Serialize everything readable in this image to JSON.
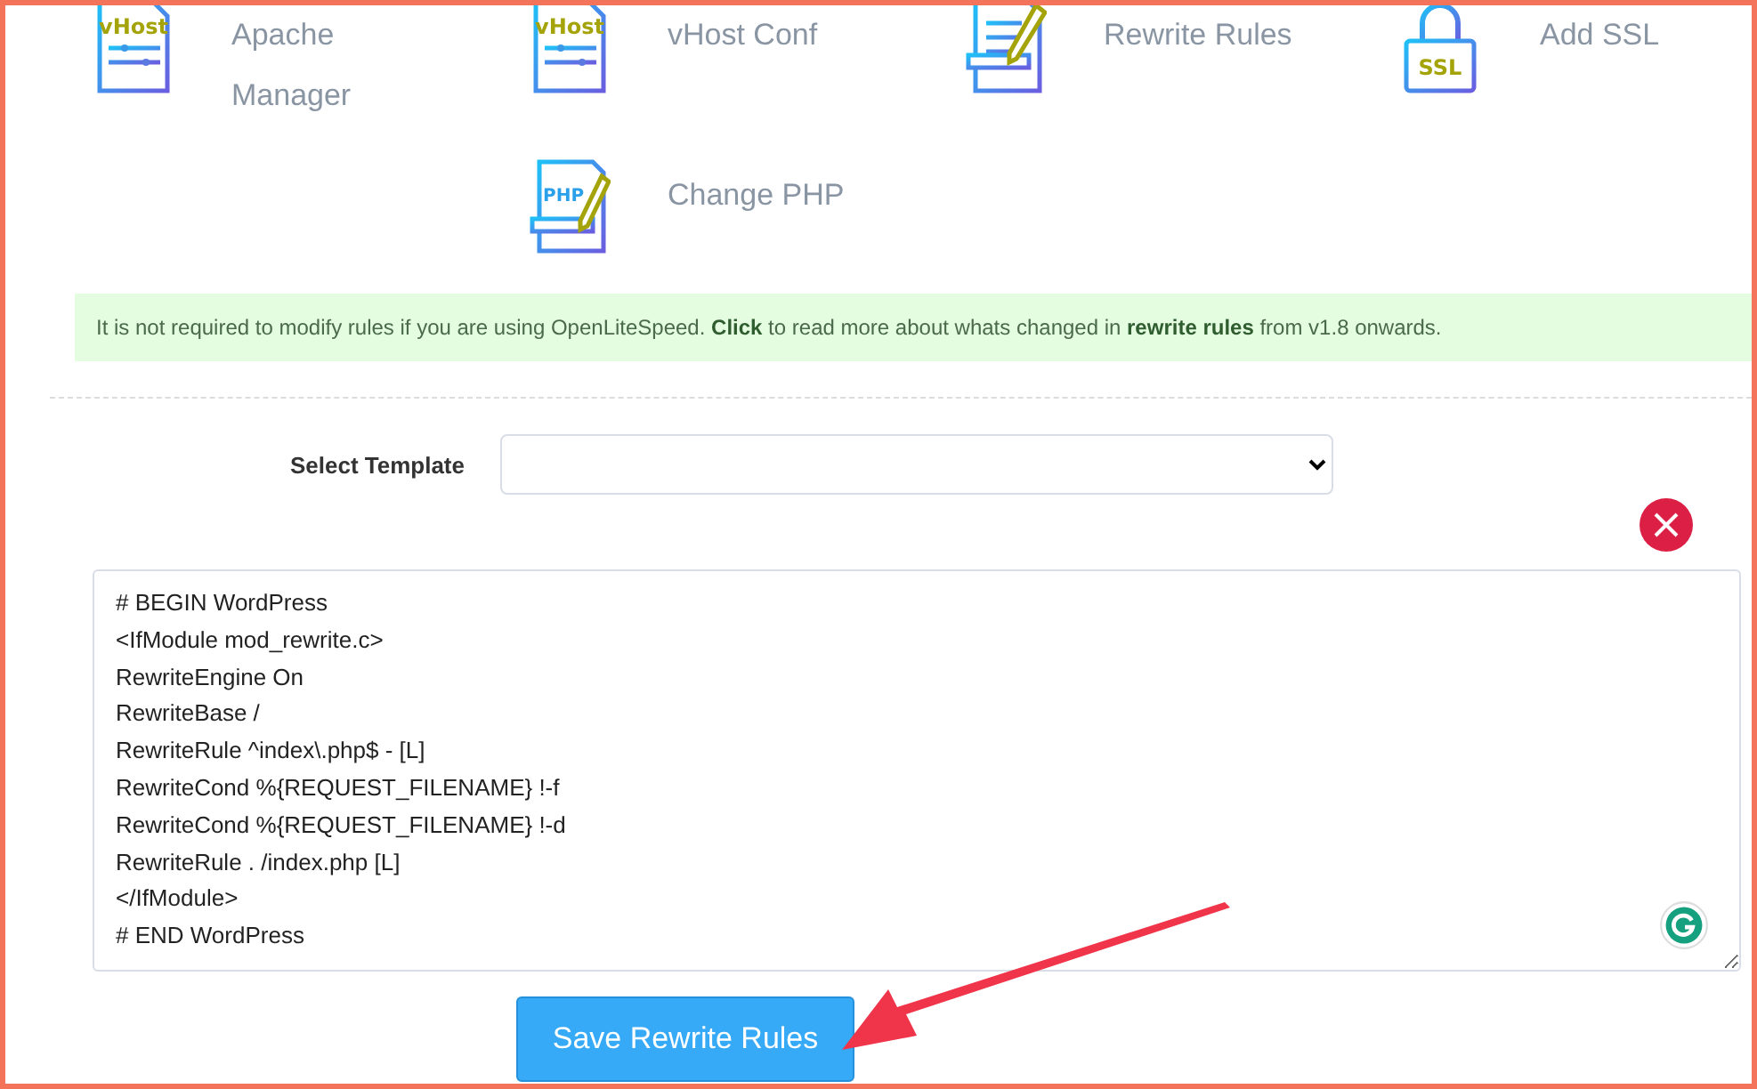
{
  "tiles": [
    {
      "label": "Apache Manager",
      "kind": "sliders",
      "icon_text": "vHost"
    },
    {
      "label": "vHost Conf",
      "kind": "sliders",
      "icon_text": "vHost"
    },
    {
      "label": "Rewrite Rules",
      "kind": "pencil"
    },
    {
      "label": "Add SSL",
      "kind": "lock",
      "icon_text": "SSL"
    },
    {
      "label": "Change PHP",
      "kind": "pencil-text",
      "icon_text": "PHP"
    }
  ],
  "notice": "It is not required to modify rules if you are using OpenLiteSpeed. **Click** to read more about whats changed in **rewrite rules** from v1.8 onwards.",
  "template_select": {
    "label": "Select Template"
  },
  "editor": {
    "lines": [
      "# BEGIN WordPress",
      "<IfModule mod_rewrite.c>",
      "RewriteEngine On",
      "RewriteBase /",
      "RewriteRule ^index\\.php$ - [L]",
      "RewriteCond %{REQUEST_FILENAME} !-f",
      "RewriteCond %{REQUEST_FILENAME} !-d",
      "RewriteRule . /index.php [L]",
      "</IfModule>",
      "# END WordPress"
    ]
  },
  "save_button": "Save Rewrite Rules"
}
